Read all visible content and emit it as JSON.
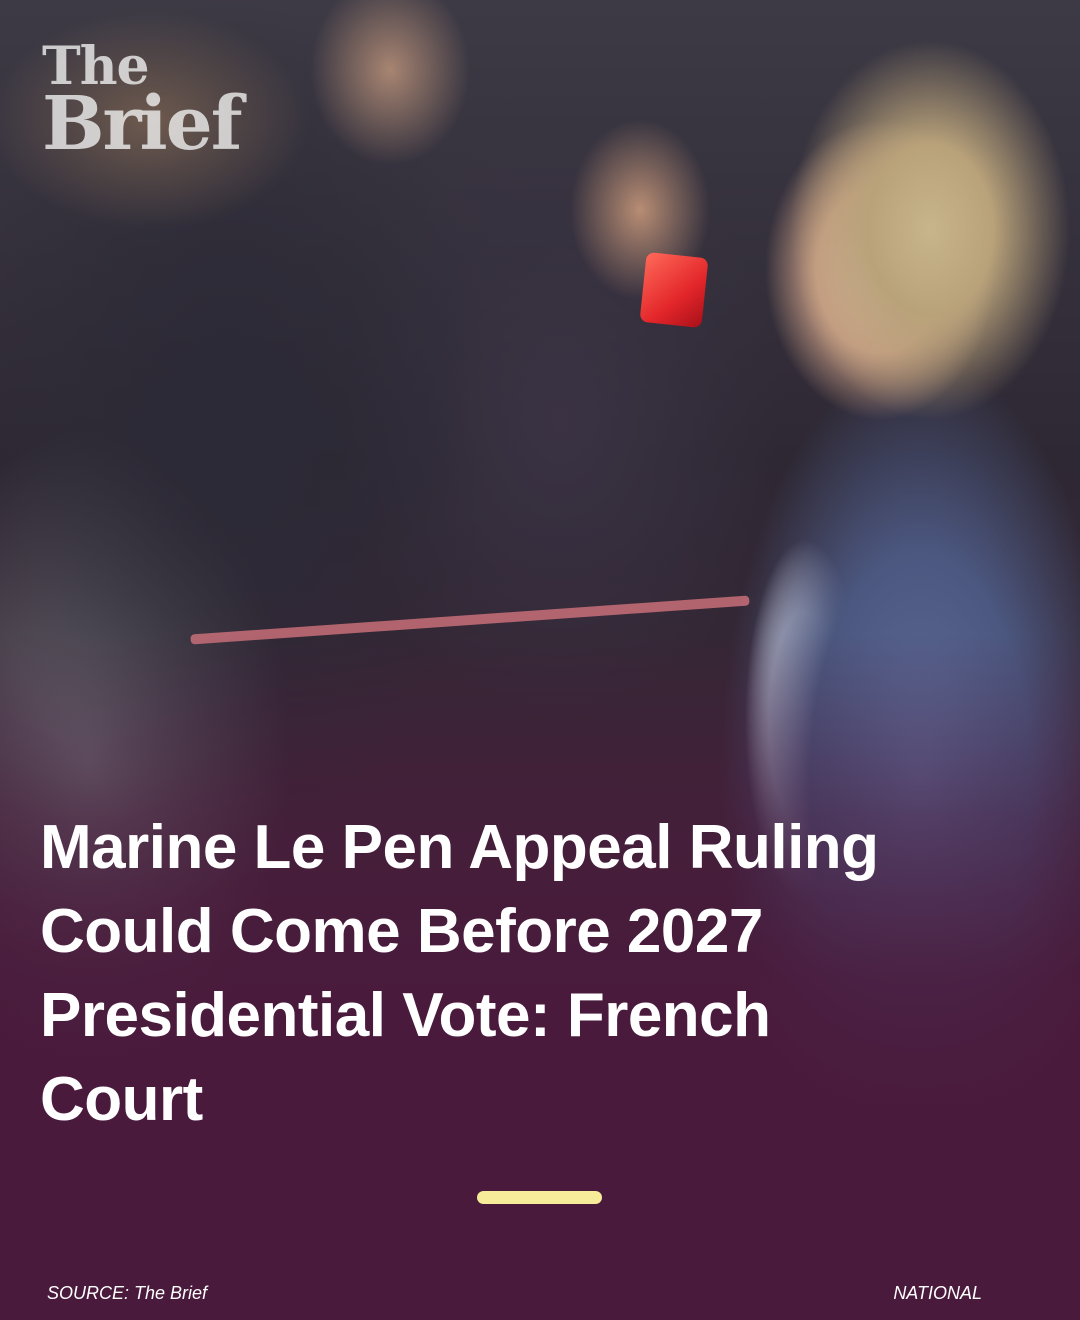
{
  "brand": {
    "logo_line1": "The",
    "logo_line2": "Brief"
  },
  "article": {
    "headline": "Marine Le Pen Appeal Ruling Could Come Before 2027 Presidential Vote: French Court"
  },
  "footer": {
    "source": "SOURCE: The Brief",
    "category": "NATIONAL"
  },
  "colors": {
    "background": "#4a1a3c",
    "accent": "#f7ec99",
    "text": "#ffffff"
  }
}
